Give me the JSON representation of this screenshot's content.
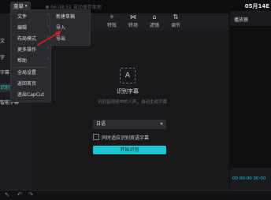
{
  "topbar": {
    "menu_label": "菜单",
    "autosave_text": "06:48:52 自动保存本地",
    "project_date": "05月14E"
  },
  "main_menu": [
    {
      "label": "文件",
      "has_submenu": true
    },
    {
      "label": "编辑",
      "has_submenu": true
    },
    {
      "label": "布局模式",
      "has_submenu": true
    },
    {
      "label": "更多操作",
      "has_submenu": true
    },
    {
      "label": "帮助",
      "has_submenu": true
    },
    {
      "label": "全局设置",
      "has_submenu": false
    },
    {
      "label": "返回首页",
      "has_submenu": false
    },
    {
      "label": "退出CapCut",
      "has_submenu": false
    }
  ],
  "file_submenu": [
    "新建草稿",
    "导入",
    "导出"
  ],
  "left_panel": [
    "文",
    "字",
    "字幕",
    "识别字幕",
    "智能字幕"
  ],
  "toolbar": [
    {
      "label": "特效",
      "icon": "sparkle-icon"
    },
    {
      "label": "转场",
      "icon": "transition-icon"
    },
    {
      "label": "滤镜",
      "icon": "filter-icon"
    },
    {
      "label": "调节",
      "icon": "adjust-icon"
    }
  ],
  "subtitle_panel": {
    "icon_text": "A",
    "title": "识别字幕",
    "description": "识别音视频中的人声，自动生成字幕",
    "language_value": "日语",
    "bilingual_label": "同时适应识别双语字幕",
    "start_button": "开始识别"
  },
  "player": {
    "title": "播放器",
    "timecode": "00:00:00 00:00"
  },
  "colors": {
    "accent": "#1cc5d0",
    "background": "#141416",
    "menu_bg": "#2a2b30",
    "annotation_arrow": "#d21f1f"
  }
}
